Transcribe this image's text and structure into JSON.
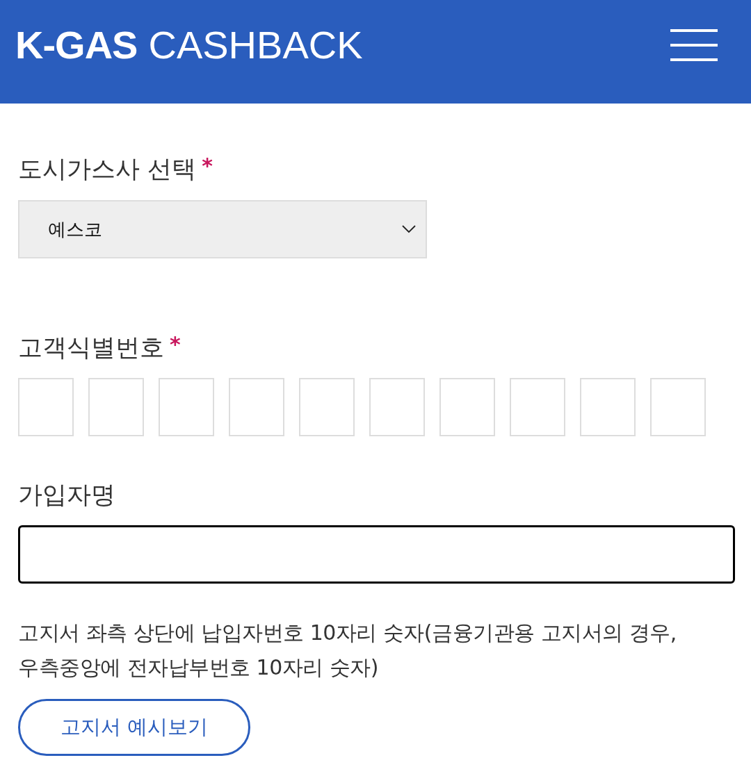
{
  "header": {
    "logo_bold": "K-GAS",
    "logo_light": "CASHBACK"
  },
  "fields": [
    {
      "kind": "select",
      "label": "도시가스사 선택",
      "required_mark": "*",
      "value": "예스코"
    },
    {
      "kind": "digits",
      "label": "고객식별번호",
      "required_mark": "*",
      "boxes": [
        {
          "filled": false
        },
        {
          "filled": false
        },
        {
          "filled": false
        },
        {
          "filled": false
        },
        {
          "filled": false
        },
        {
          "filled": false
        },
        {
          "filled": false
        },
        {
          "filled": false
        },
        {
          "filled": false
        },
        {
          "filled": false
        }
      ]
    },
    {
      "kind": "text",
      "label": "가입자명",
      "focused": true
    }
  ],
  "help_text": "고지서 좌측 상단에 납입자번호 10자리 숫자(금융기관용 고지서의 경우, 우측중앙에 전자납부번호 10자리 숫자)",
  "example_button": "고지서 예시보기"
}
